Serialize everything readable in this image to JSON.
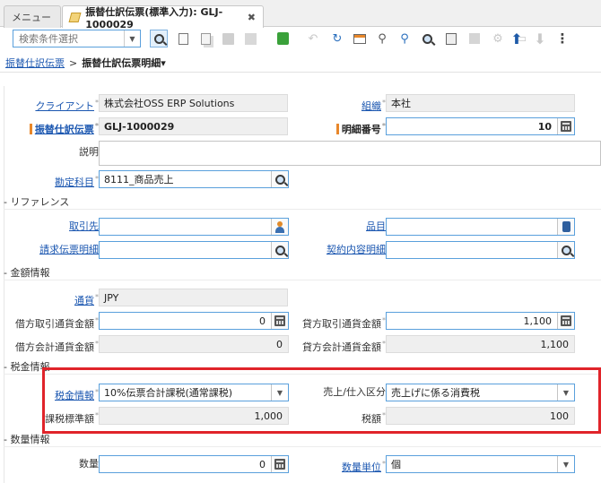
{
  "tabs": [
    {
      "label": "メニュー"
    },
    {
      "label": "振替仕訳伝票(標準入力): GLJ-1000029",
      "close": "✖"
    }
  ],
  "toolbar": {
    "search_placeholder": "検索条件選択"
  },
  "breadcrumb": {
    "parent": "振替仕訳伝票",
    "separator": ">",
    "current": "振替仕訳伝票明細▾"
  },
  "form": {
    "client": {
      "label": "クライアント",
      "value": "株式会社OSS ERP Solutions"
    },
    "org": {
      "label": "組織",
      "value": "本社"
    },
    "journal": {
      "label": "振替仕訳伝票",
      "value": "GLJ-1000029"
    },
    "line_no": {
      "label": "明細番号",
      "value": "10"
    },
    "description": {
      "label": "説明",
      "value": ""
    },
    "account": {
      "label": "勘定科目",
      "value": "8111_商品売上"
    }
  },
  "sections": {
    "reference": "- リファレンス",
    "amount": "- 金額情報",
    "tax": "- 税金情報",
    "qty": "- 数量情報"
  },
  "reference": {
    "bpartner": {
      "label": "取引先",
      "value": ""
    },
    "product": {
      "label": "品目",
      "value": ""
    },
    "invoice_line": {
      "label": "請求伝票明細",
      "value": ""
    },
    "contract_line": {
      "label": "契約内容明細",
      "value": ""
    }
  },
  "amount": {
    "currency": {
      "label": "通貨",
      "value": "JPY"
    },
    "dr_source": {
      "label": "借方取引通貨金額",
      "value": "0"
    },
    "cr_source": {
      "label": "貸方取引通貨金額",
      "value": "1,100"
    },
    "dr_acct": {
      "label": "借方会計通貨金額",
      "value": "0"
    },
    "cr_acct": {
      "label": "貸方会計通貨金額",
      "value": "1,100"
    }
  },
  "tax": {
    "tax_info": {
      "label": "税金情報",
      "value": "10%伝票合計課税(通常課税)"
    },
    "sales_purchase": {
      "label": "売上/仕入区分",
      "value": "売上げに係る消費税"
    },
    "tax_base": {
      "label": "課税標準額",
      "value": "1,000"
    },
    "tax_amt": {
      "label": "税額",
      "value": "100"
    }
  },
  "qty": {
    "qty": {
      "label": "数量",
      "value": "0"
    },
    "uom": {
      "label": "数量単位",
      "value": "個"
    }
  },
  "colors": {
    "accent": "#e8872a",
    "link": "#1a56b0",
    "highlight": "#e0242a"
  }
}
